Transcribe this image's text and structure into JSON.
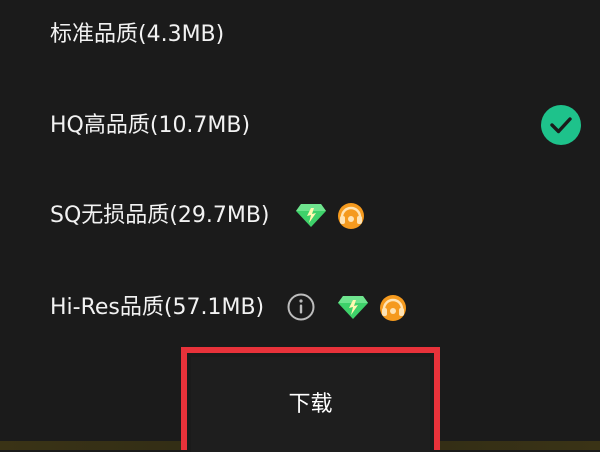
{
  "quality_options": [
    {
      "label": "标准品质(4.3MB)",
      "selected": false
    },
    {
      "label": "HQ高品质(10.7MB)",
      "selected": true
    },
    {
      "label": "SQ无损品质(29.7MB)",
      "selected": false,
      "badges": [
        "diamond-icon",
        "vip-headphones-icon"
      ]
    },
    {
      "label": "Hi-Res品质(57.1MB)",
      "selected": false,
      "badges": [
        "info-icon",
        "diamond-icon",
        "vip-headphones-icon"
      ]
    }
  ],
  "download_button": {
    "label": "下载"
  },
  "colors": {
    "background": "#1b1b1b",
    "check_green": "#1ec28b",
    "highlight_red": "#e8323a",
    "diamond_green": "#3ed16a",
    "vip_orange": "#f59a1e"
  }
}
